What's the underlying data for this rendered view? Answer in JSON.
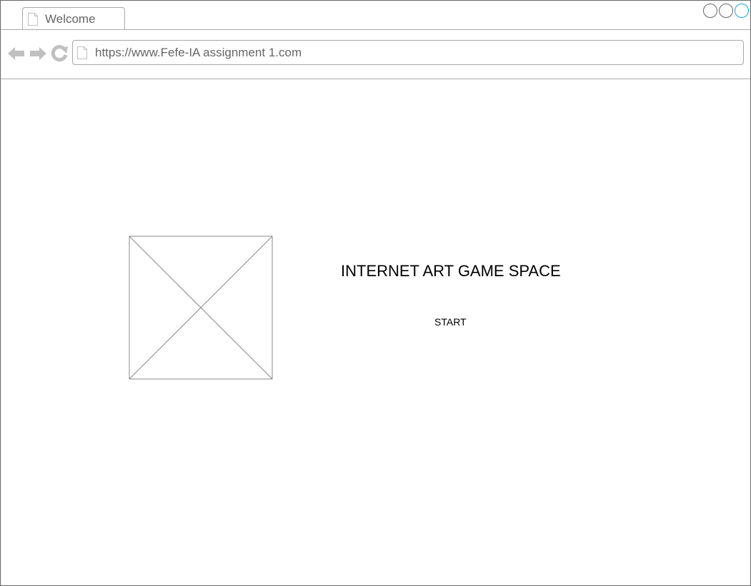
{
  "browser": {
    "tab": {
      "label": "Welcome",
      "icon": "page-icon"
    },
    "window_controls": [
      "minimize-icon",
      "maximize-icon",
      "close-icon"
    ],
    "nav": {
      "back_icon": "back-arrow-icon",
      "forward_icon": "forward-arrow-icon",
      "reload_icon": "reload-icon"
    },
    "address": {
      "url": "https://www.Fefe-IA assignment 1.com",
      "icon": "page-icon"
    }
  },
  "main": {
    "image_placeholder_icon": "image-placeholder-icon",
    "title": "INTERNET ART GAME SPACE",
    "start_label": "START"
  },
  "colors": {
    "border": "#666666",
    "ui_gray": "#a8a8a8",
    "icon_gray": "#c0c0c0",
    "active_control": "#1ba1e2",
    "text": "#000000"
  }
}
